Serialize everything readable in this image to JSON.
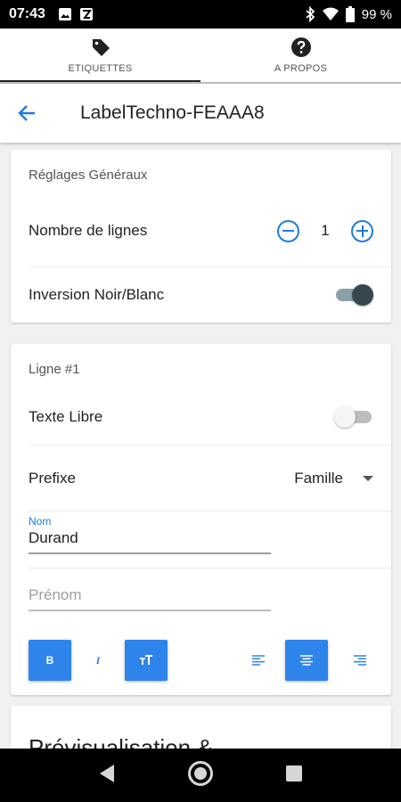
{
  "status": {
    "time": "07:43",
    "battery": "99 %"
  },
  "tabs": [
    {
      "label": "ETIQUETTES",
      "icon": "label-tag-icon",
      "active": true
    },
    {
      "label": "A PROPOS",
      "icon": "help-circle-icon",
      "active": false
    }
  ],
  "appbar": {
    "title": "LabelTechno-FEAAA8",
    "back_icon": "arrow-back-icon"
  },
  "general": {
    "header": "Réglages Généraux",
    "lines_label": "Nombre de lignes",
    "lines_value": "1",
    "invert_label": "Inversion Noir/Blanc",
    "invert_on": true
  },
  "line1": {
    "header": "Ligne #1",
    "free_text_label": "Texte Libre",
    "free_text_on": false,
    "prefix_label": "Prefixe",
    "prefix_value": "Famille",
    "nom_label": "Nom",
    "nom_value": "Durand",
    "prenom_placeholder": "Prénom",
    "format_buttons": [
      {
        "name": "bold-button",
        "glyph": "B",
        "active": true
      },
      {
        "name": "italic-button",
        "glyph": "I",
        "active": false
      },
      {
        "name": "text-size-button",
        "glyph": "TT",
        "active": true
      },
      {
        "name": "align-left-button",
        "glyph": "align-left",
        "active": false
      },
      {
        "name": "align-center-button",
        "glyph": "align-center",
        "active": true
      },
      {
        "name": "align-right-button",
        "glyph": "align-right",
        "active": false
      }
    ]
  },
  "preview": {
    "title": "Prévisualisation &"
  },
  "colors": {
    "accent": "#1e7be0",
    "button_blue": "#2f84eb"
  }
}
